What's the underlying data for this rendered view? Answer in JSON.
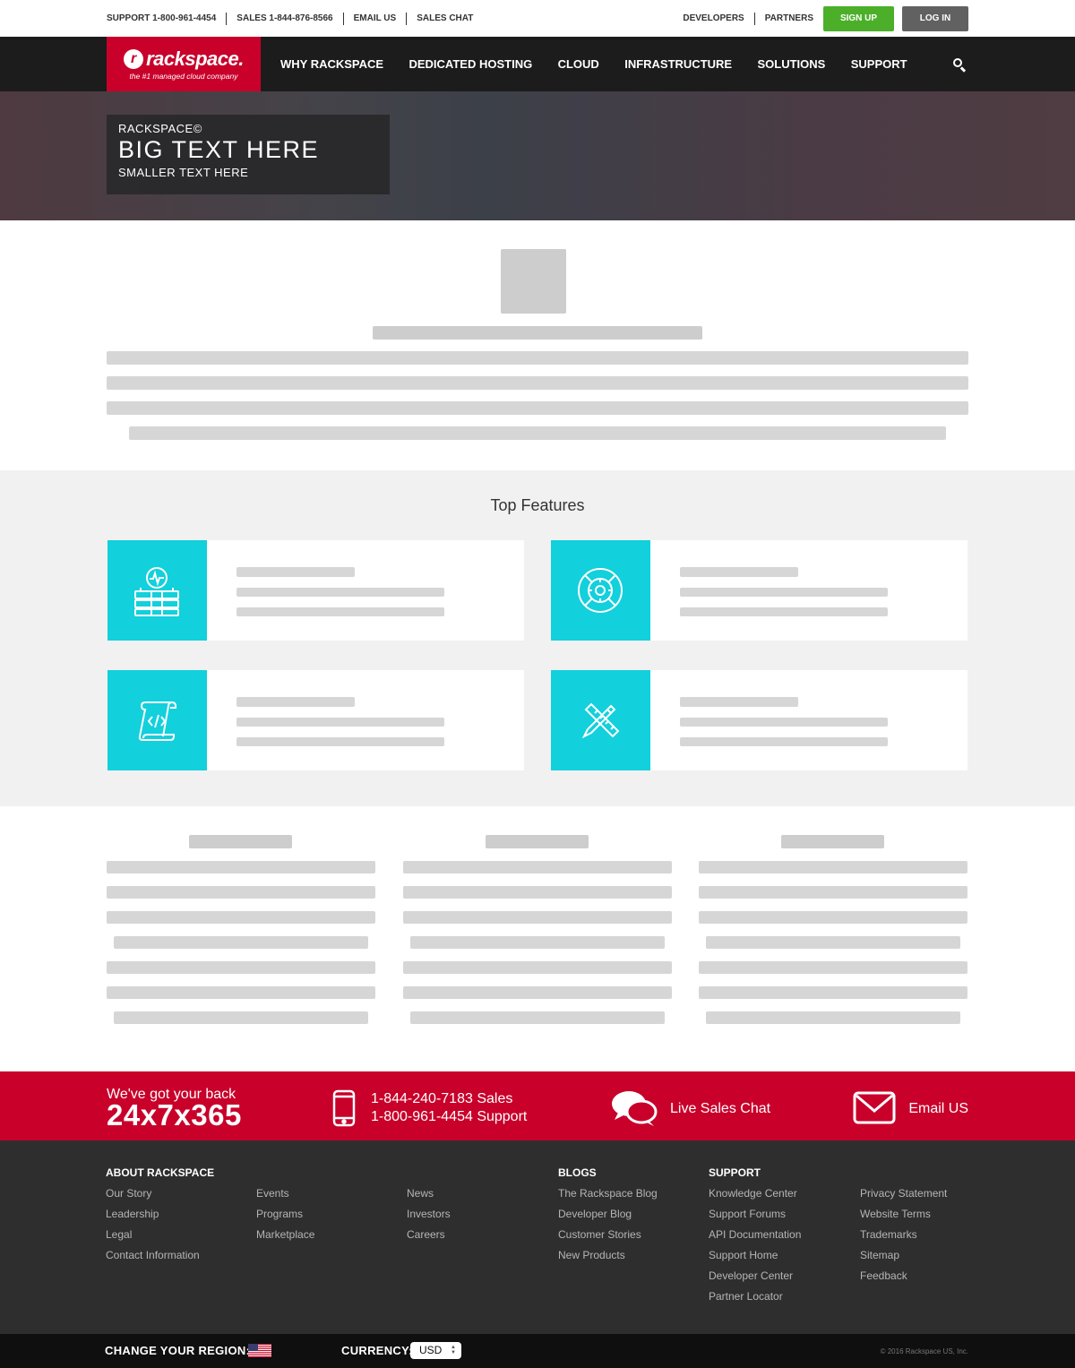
{
  "utility": {
    "support": "SUPPORT 1-800-961-4454",
    "sales": "SALES 1-844-876-8566",
    "email": "EMAIL US",
    "chat": "SALES CHAT",
    "developers": "DEVELOPERS",
    "partners": "PARTNERS",
    "signup": "SIGN UP",
    "login": "LOG IN"
  },
  "logo": {
    "word": "rackspace.",
    "tagline": "the #1 managed cloud company"
  },
  "nav": {
    "items": [
      "WHY RACKSPACE",
      "DEDICATED HOSTING",
      "CLOUD",
      "INFRASTRUCTURE",
      "SOLUTIONS",
      "SUPPORT"
    ],
    "search_icon": "search-icon"
  },
  "hero": {
    "eyebrow": "RACKSPACE©",
    "title": "BIG TEXT HERE",
    "subtitle": "SMALLER TEXT HERE"
  },
  "features": {
    "title": "Top Features",
    "icons": [
      "server-monitor-icon",
      "lifebuoy-gear-icon",
      "code-scroll-icon",
      "design-tools-icon"
    ]
  },
  "contact": {
    "tagline": "We've got your back",
    "hours": "24x7x365",
    "phone_sales": "1-844-240-7183 Sales",
    "phone_support": "1-800-961-4454 Support",
    "chat": "Live Sales Chat",
    "email": "Email US",
    "icons": [
      "phone-icon",
      "chat-icon",
      "mail-icon"
    ],
    "accent": "#c8002a"
  },
  "footer": {
    "about_heading": "ABOUT RACKSPACE",
    "col1": [
      "Our Story",
      "Leadership",
      "Legal",
      "Contact Information"
    ],
    "col2": [
      "Events",
      "Programs",
      "Marketplace"
    ],
    "col3": [
      "News",
      "Investors",
      "Careers"
    ],
    "blogs_heading": "BLOGS",
    "blogs": [
      "The Rackspace Blog",
      "Developer Blog",
      "Customer Stories",
      "New Products"
    ],
    "support_heading": "SUPPORT",
    "support": [
      "Knowledge Center",
      "Support Forums",
      "API Documentation",
      "Support Home",
      "Developer Center",
      "Partner Locator"
    ],
    "legal": [
      "Privacy Statement",
      "Website Terms",
      "Trademarks",
      "Sitemap",
      "Feedback"
    ]
  },
  "bottom": {
    "region_label": "CHANGE YOUR REGION:",
    "currency_label": "CURRENCY:",
    "currency_value": "USD",
    "copyright": "© 2016 Rackspace US, Inc."
  },
  "colors": {
    "brand_red": "#c8002a",
    "signup_green": "#4caf2a",
    "feature_cyan": "#12d0dc"
  }
}
